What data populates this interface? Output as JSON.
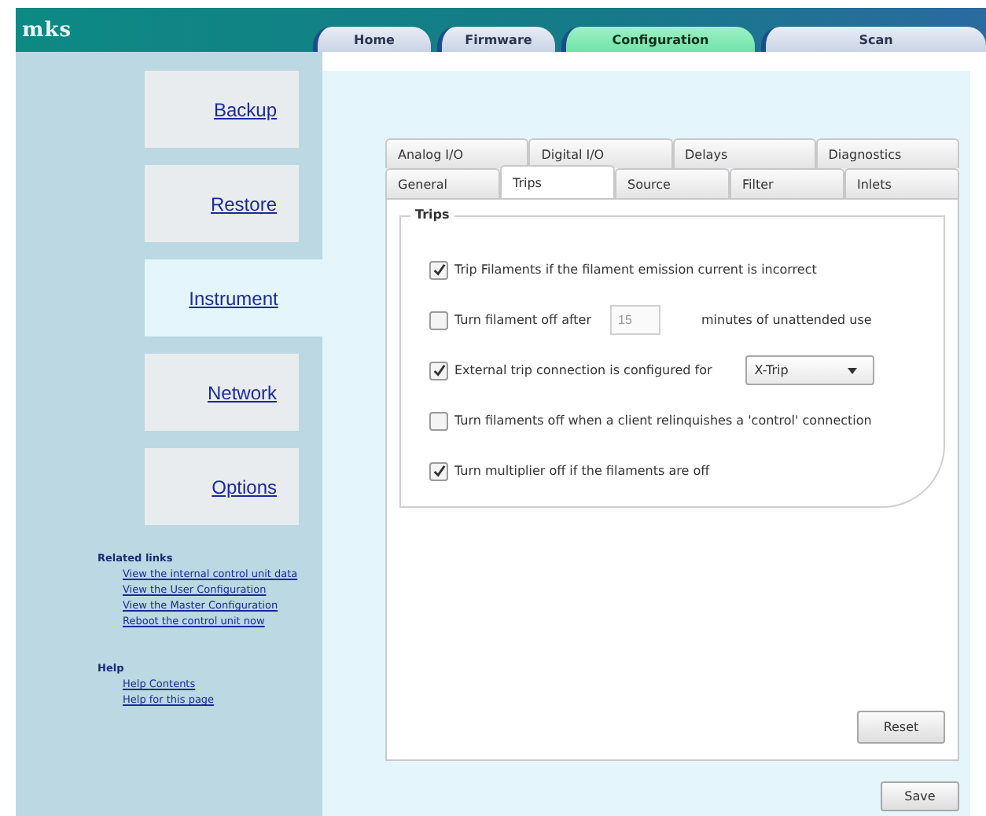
{
  "header": {
    "logo": "mks"
  },
  "nav_tabs": [
    {
      "label": "Home",
      "selected": false
    },
    {
      "label": "Firmware",
      "selected": false
    },
    {
      "label": "Configuration",
      "selected": true
    },
    {
      "label": "Scan",
      "selected": false
    }
  ],
  "sidebar": {
    "items": [
      {
        "label": "Backup",
        "selected": false
      },
      {
        "label": "Restore",
        "selected": false
      },
      {
        "label": "Instrument",
        "selected": true
      },
      {
        "label": "Network",
        "selected": false
      },
      {
        "label": "Options",
        "selected": false
      }
    ],
    "link_groups": [
      {
        "title": "Related links",
        "links": [
          "View the internal control unit data",
          "View the User Configuration",
          "View the Master Configuration",
          "Reboot the control unit now"
        ]
      },
      {
        "title": "Help",
        "links": [
          "Help Contents",
          "Help for this page"
        ]
      }
    ]
  },
  "tab_rows": [
    [
      {
        "label": "Analog I/O",
        "selected": false
      },
      {
        "label": "Digital I/O",
        "selected": false
      },
      {
        "label": "Delays",
        "selected": false
      },
      {
        "label": "Diagnostics",
        "selected": false
      }
    ],
    [
      {
        "label": "General",
        "selected": false
      },
      {
        "label": "Trips",
        "selected": true
      },
      {
        "label": "Source",
        "selected": false
      },
      {
        "label": "Filter",
        "selected": false
      },
      {
        "label": "Inlets",
        "selected": false
      }
    ]
  ],
  "group": {
    "title": "Trips",
    "options": [
      {
        "kind": "checkbox",
        "label": "Trip Filaments if the filament emission current is incorrect",
        "checked": true
      },
      {
        "kind": "number",
        "label": "Turn filament off after",
        "checked": false,
        "value": "15",
        "suffix": "minutes of unattended use"
      },
      {
        "kind": "select",
        "label": "External trip connection is configured for",
        "checked": true,
        "value": "X-Trip"
      },
      {
        "kind": "checkbox",
        "label": "Turn filaments off when a client relinquishes a 'control' connection",
        "checked": false
      },
      {
        "kind": "checkbox",
        "label": "Turn multiplier off if the filaments are off",
        "checked": true
      }
    ]
  },
  "buttons": {
    "reset": "Reset",
    "save": "Save"
  }
}
